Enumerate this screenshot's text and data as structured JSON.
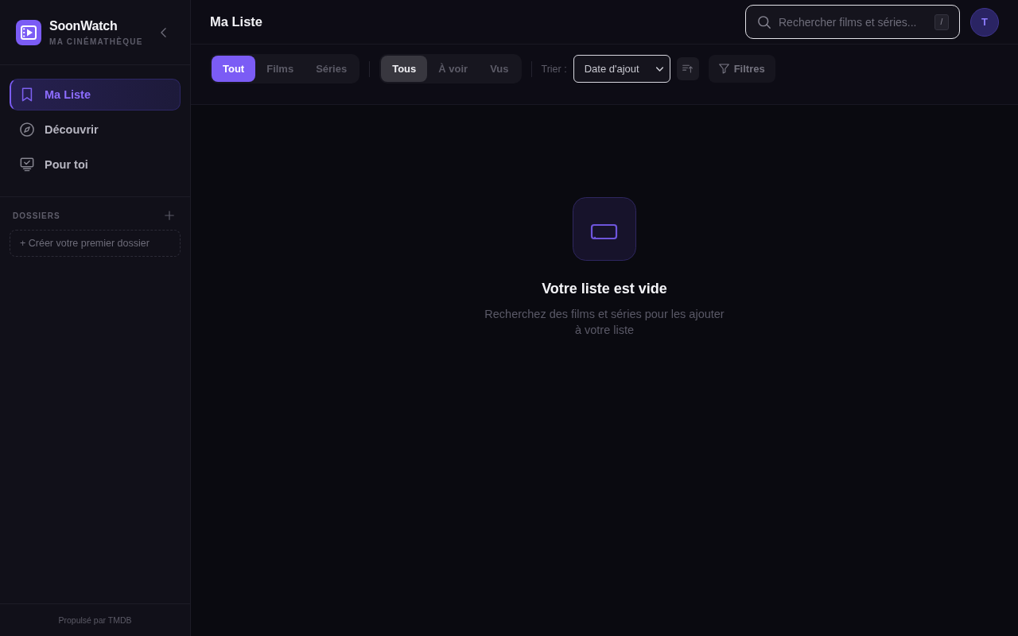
{
  "sidebar": {
    "brand": {
      "name": "SoonWatch",
      "tagline": "MA CINÉMATHÈQUE"
    },
    "nav": [
      {
        "label": "Ma Liste",
        "selected": true
      },
      {
        "label": "Découvrir",
        "selected": false
      },
      {
        "label": "Pour toi",
        "selected": false
      }
    ],
    "folders": {
      "heading": "DOSSIERS",
      "create_button": "+ Créer votre premier dossier"
    },
    "footer": "Propulsé par TMDB"
  },
  "header": {
    "title": "Ma Liste",
    "search": {
      "placeholder": "Rechercher films et séries...",
      "shortcut": "/"
    },
    "avatar": "T"
  },
  "toolbar": {
    "type_filter": [
      {
        "label": "Tout",
        "selected": true
      },
      {
        "label": "Films",
        "selected": false
      },
      {
        "label": "Séries",
        "selected": false
      }
    ],
    "status_filter": [
      {
        "label": "Tous",
        "selected": true
      },
      {
        "label": "À voir",
        "selected": false
      },
      {
        "label": "Vus",
        "selected": false
      }
    ],
    "sort": {
      "label": "Trier :",
      "value": "Date d'ajout"
    },
    "filters_button": "Filtres"
  },
  "empty_state": {
    "title": "Votre liste est vide",
    "description": "Recherchez des films et séries pour les ajouter à votre liste"
  }
}
